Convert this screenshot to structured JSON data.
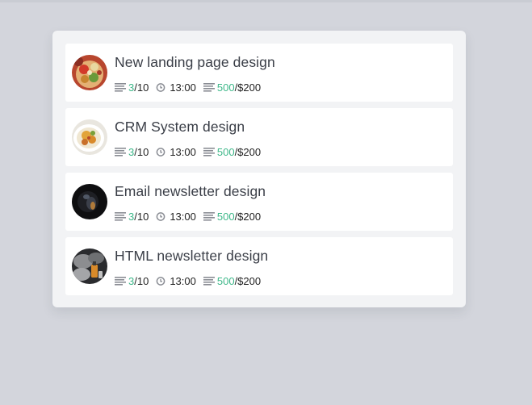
{
  "colors": {
    "background": "#d3d5dc",
    "panel": "#f2f3f5",
    "card": "#ffffff",
    "title_text": "#3a3e47",
    "accent_green": "#3fb88a",
    "icon_gray": "#8a8d94"
  },
  "tasks": [
    {
      "title": "New landing page design",
      "thumbnail": "food-salad-thumbnail",
      "tasks_done": "3",
      "tasks_total": "/10",
      "time": "13:00",
      "spent": "500",
      "budget": "/$200"
    },
    {
      "title": "CRM System design",
      "thumbnail": "food-plate-thumbnail",
      "tasks_done": "3",
      "tasks_total": "/10",
      "time": "13:00",
      "spent": "500",
      "budget": "/$200"
    },
    {
      "title": "Email newsletter design",
      "thumbnail": "dark-object-thumbnail",
      "tasks_done": "3",
      "tasks_total": "/10",
      "time": "13:00",
      "spent": "500",
      "budget": "/$200"
    },
    {
      "title": "HTML newsletter design",
      "thumbnail": "smoke-bottle-thumbnail",
      "tasks_done": "3",
      "tasks_total": "/10",
      "time": "13:00",
      "spent": "500",
      "budget": "/$200"
    }
  ]
}
